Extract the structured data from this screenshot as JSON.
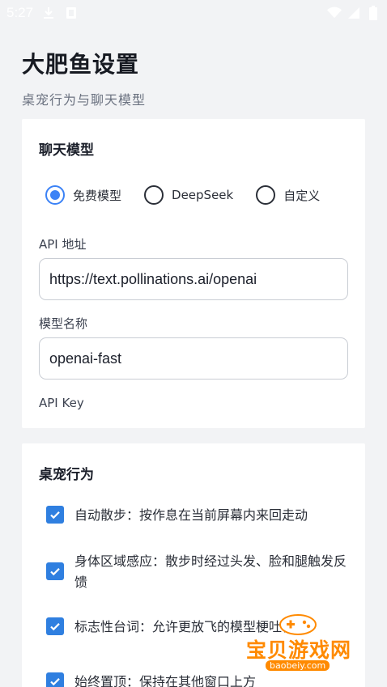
{
  "status_bar": {
    "time": "5:27"
  },
  "header": {
    "title": "大肥鱼设置",
    "subtitle": "桌宠行为与聊天模型"
  },
  "chat_model": {
    "title": "聊天模型",
    "options": [
      {
        "label": "免费模型",
        "selected": true
      },
      {
        "label": "DeepSeek",
        "selected": false
      },
      {
        "label": "自定义",
        "selected": false
      }
    ],
    "api_url_label": "API 地址",
    "api_url_value": "https://text.pollinations.ai/openai",
    "model_name_label": "模型名称",
    "model_name_value": "openai-fast",
    "api_key_label": "API Key"
  },
  "pet_behavior": {
    "title": "桌宠行为",
    "items": [
      {
        "text": "自动散步：按作息在当前屏幕内来回走动",
        "checked": true
      },
      {
        "text": "身体区域感应：散步时经过头发、脸和腿触发反馈",
        "checked": true
      },
      {
        "text": "标志性台词：允许更放飞的模型梗吐槽",
        "checked": true
      },
      {
        "text": "始终置顶：保持在其他窗口上方",
        "checked": true
      }
    ]
  },
  "watermark": {
    "text": "宝贝游戏网",
    "url": "baobeiy.com"
  },
  "colors": {
    "accent": "#3b82f6",
    "checkbox": "#2f7fe0",
    "background": "#f2f3f5"
  }
}
